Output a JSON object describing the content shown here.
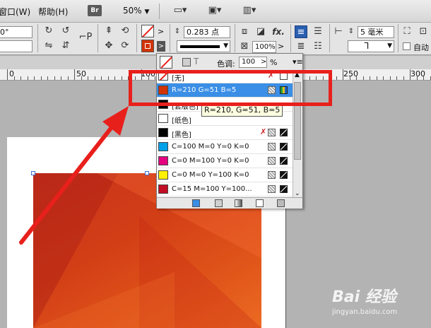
{
  "menu": {
    "window": "窗口(W)",
    "help": "帮助(H)",
    "bridge": "Br",
    "zoom": "50%"
  },
  "control_panel": {
    "angle_value": "0°",
    "stroke_weight": "0.283 点",
    "spacing_value": "5 毫米",
    "opacity": "100%",
    "auto_fit_label": "自动"
  },
  "ruler": {
    "labels": [
      "0",
      "50",
      "100",
      "250",
      "300"
    ]
  },
  "swatch_panel": {
    "tint_label": "色调:",
    "tint_value": "100",
    "percent": "%",
    "stroke_mode": "T",
    "swatches": [
      {
        "name": "[无]",
        "color": "none"
      },
      {
        "name": "R=210 G=51 B=5",
        "color": "#d23305",
        "selected": true
      },
      {
        "name": "[套版色]",
        "color": "#000000"
      },
      {
        "name": "[纸色]",
        "color": "#ffffff"
      },
      {
        "name": "[黑色]",
        "color": "#000000"
      },
      {
        "name": "C=100 M=0 Y=0 K=0",
        "color": "#00a0e9"
      },
      {
        "name": "C=0 M=100 Y=0 K=0",
        "color": "#e4007f"
      },
      {
        "name": "C=0 M=0 Y=100 K=0",
        "color": "#fff100"
      },
      {
        "name": "C=15 M=100 Y=100...",
        "color": "#c30d23"
      }
    ]
  },
  "tooltip": "R=210, G=51, B=5",
  "watermark": {
    "brand": "Bai 经验",
    "url": "jingyan.baidu.com"
  },
  "colors": {
    "highlight": "#e8201c",
    "selection": "#3a8ee6",
    "arrow": "#e8201c"
  }
}
